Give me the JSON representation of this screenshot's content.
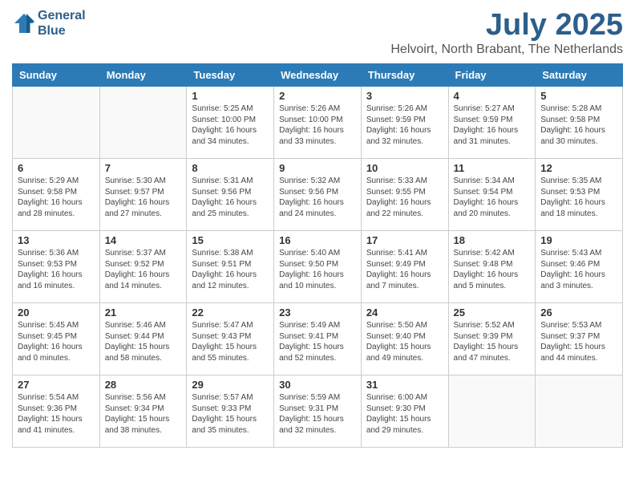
{
  "logo": {
    "line1": "General",
    "line2": "Blue"
  },
  "title": "July 2025",
  "location": "Helvoirt, North Brabant, The Netherlands",
  "days_of_week": [
    "Sunday",
    "Monday",
    "Tuesday",
    "Wednesday",
    "Thursday",
    "Friday",
    "Saturday"
  ],
  "weeks": [
    [
      {
        "day": "",
        "info": ""
      },
      {
        "day": "",
        "info": ""
      },
      {
        "day": "1",
        "info": "Sunrise: 5:25 AM\nSunset: 10:00 PM\nDaylight: 16 hours\nand 34 minutes."
      },
      {
        "day": "2",
        "info": "Sunrise: 5:26 AM\nSunset: 10:00 PM\nDaylight: 16 hours\nand 33 minutes."
      },
      {
        "day": "3",
        "info": "Sunrise: 5:26 AM\nSunset: 9:59 PM\nDaylight: 16 hours\nand 32 minutes."
      },
      {
        "day": "4",
        "info": "Sunrise: 5:27 AM\nSunset: 9:59 PM\nDaylight: 16 hours\nand 31 minutes."
      },
      {
        "day": "5",
        "info": "Sunrise: 5:28 AM\nSunset: 9:58 PM\nDaylight: 16 hours\nand 30 minutes."
      }
    ],
    [
      {
        "day": "6",
        "info": "Sunrise: 5:29 AM\nSunset: 9:58 PM\nDaylight: 16 hours\nand 28 minutes."
      },
      {
        "day": "7",
        "info": "Sunrise: 5:30 AM\nSunset: 9:57 PM\nDaylight: 16 hours\nand 27 minutes."
      },
      {
        "day": "8",
        "info": "Sunrise: 5:31 AM\nSunset: 9:56 PM\nDaylight: 16 hours\nand 25 minutes."
      },
      {
        "day": "9",
        "info": "Sunrise: 5:32 AM\nSunset: 9:56 PM\nDaylight: 16 hours\nand 24 minutes."
      },
      {
        "day": "10",
        "info": "Sunrise: 5:33 AM\nSunset: 9:55 PM\nDaylight: 16 hours\nand 22 minutes."
      },
      {
        "day": "11",
        "info": "Sunrise: 5:34 AM\nSunset: 9:54 PM\nDaylight: 16 hours\nand 20 minutes."
      },
      {
        "day": "12",
        "info": "Sunrise: 5:35 AM\nSunset: 9:53 PM\nDaylight: 16 hours\nand 18 minutes."
      }
    ],
    [
      {
        "day": "13",
        "info": "Sunrise: 5:36 AM\nSunset: 9:53 PM\nDaylight: 16 hours\nand 16 minutes."
      },
      {
        "day": "14",
        "info": "Sunrise: 5:37 AM\nSunset: 9:52 PM\nDaylight: 16 hours\nand 14 minutes."
      },
      {
        "day": "15",
        "info": "Sunrise: 5:38 AM\nSunset: 9:51 PM\nDaylight: 16 hours\nand 12 minutes."
      },
      {
        "day": "16",
        "info": "Sunrise: 5:40 AM\nSunset: 9:50 PM\nDaylight: 16 hours\nand 10 minutes."
      },
      {
        "day": "17",
        "info": "Sunrise: 5:41 AM\nSunset: 9:49 PM\nDaylight: 16 hours\nand 7 minutes."
      },
      {
        "day": "18",
        "info": "Sunrise: 5:42 AM\nSunset: 9:48 PM\nDaylight: 16 hours\nand 5 minutes."
      },
      {
        "day": "19",
        "info": "Sunrise: 5:43 AM\nSunset: 9:46 PM\nDaylight: 16 hours\nand 3 minutes."
      }
    ],
    [
      {
        "day": "20",
        "info": "Sunrise: 5:45 AM\nSunset: 9:45 PM\nDaylight: 16 hours\nand 0 minutes."
      },
      {
        "day": "21",
        "info": "Sunrise: 5:46 AM\nSunset: 9:44 PM\nDaylight: 15 hours\nand 58 minutes."
      },
      {
        "day": "22",
        "info": "Sunrise: 5:47 AM\nSunset: 9:43 PM\nDaylight: 15 hours\nand 55 minutes."
      },
      {
        "day": "23",
        "info": "Sunrise: 5:49 AM\nSunset: 9:41 PM\nDaylight: 15 hours\nand 52 minutes."
      },
      {
        "day": "24",
        "info": "Sunrise: 5:50 AM\nSunset: 9:40 PM\nDaylight: 15 hours\nand 49 minutes."
      },
      {
        "day": "25",
        "info": "Sunrise: 5:52 AM\nSunset: 9:39 PM\nDaylight: 15 hours\nand 47 minutes."
      },
      {
        "day": "26",
        "info": "Sunrise: 5:53 AM\nSunset: 9:37 PM\nDaylight: 15 hours\nand 44 minutes."
      }
    ],
    [
      {
        "day": "27",
        "info": "Sunrise: 5:54 AM\nSunset: 9:36 PM\nDaylight: 15 hours\nand 41 minutes."
      },
      {
        "day": "28",
        "info": "Sunrise: 5:56 AM\nSunset: 9:34 PM\nDaylight: 15 hours\nand 38 minutes."
      },
      {
        "day": "29",
        "info": "Sunrise: 5:57 AM\nSunset: 9:33 PM\nDaylight: 15 hours\nand 35 minutes."
      },
      {
        "day": "30",
        "info": "Sunrise: 5:59 AM\nSunset: 9:31 PM\nDaylight: 15 hours\nand 32 minutes."
      },
      {
        "day": "31",
        "info": "Sunrise: 6:00 AM\nSunset: 9:30 PM\nDaylight: 15 hours\nand 29 minutes."
      },
      {
        "day": "",
        "info": ""
      },
      {
        "day": "",
        "info": ""
      }
    ]
  ]
}
